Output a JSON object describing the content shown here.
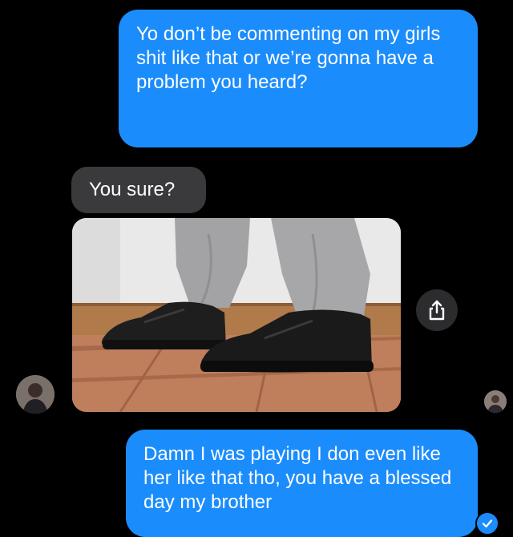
{
  "messages": [
    {
      "direction": "outgoing",
      "text": "Yo don’t be commenting on my girls shit like that or we’re gonna have a problem you heard?"
    },
    {
      "direction": "incoming",
      "text": "You sure?"
    },
    {
      "direction": "incoming",
      "attachment": "photo-of-black-sneakers"
    },
    {
      "direction": "outgoing",
      "text": "Damn I was playing I don even like her like that tho, you have a blessed day my brother"
    }
  ],
  "icons": {
    "share": "share-icon",
    "read_receipt": "checkmark-icon",
    "contact_avatar": "avatar",
    "own_avatar": "avatar"
  },
  "colors": {
    "background": "#000000",
    "outgoing_bubble": "#1b8cfb",
    "incoming_bubble": "#3a3a3c",
    "share_button": "#2c2c2e"
  }
}
